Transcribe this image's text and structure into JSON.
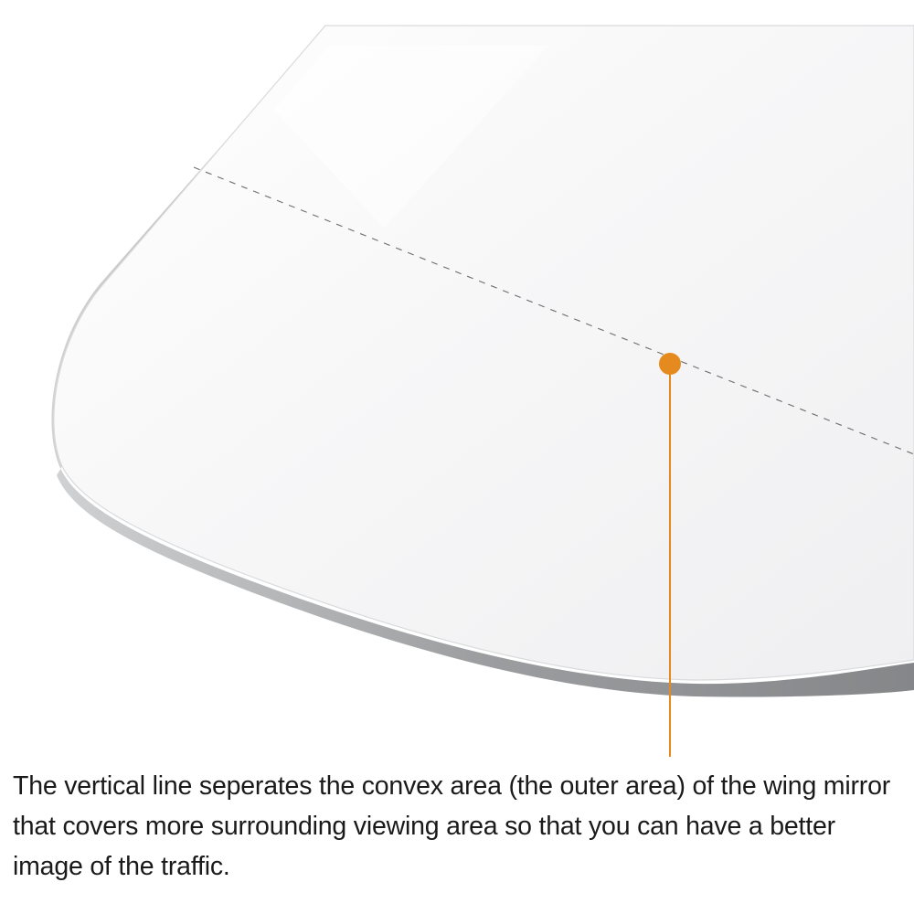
{
  "callout": {
    "accent_color": "#E58A1F",
    "caption": "The vertical line seperates the convex area (the outer area) of the wing mirror that covers more surrounding viewing area so that you can have a better image of the traffic."
  },
  "mirror": {
    "glass_color": "#F6F6F7",
    "edge_color": "#8F9193",
    "divider_style": "dashed"
  }
}
